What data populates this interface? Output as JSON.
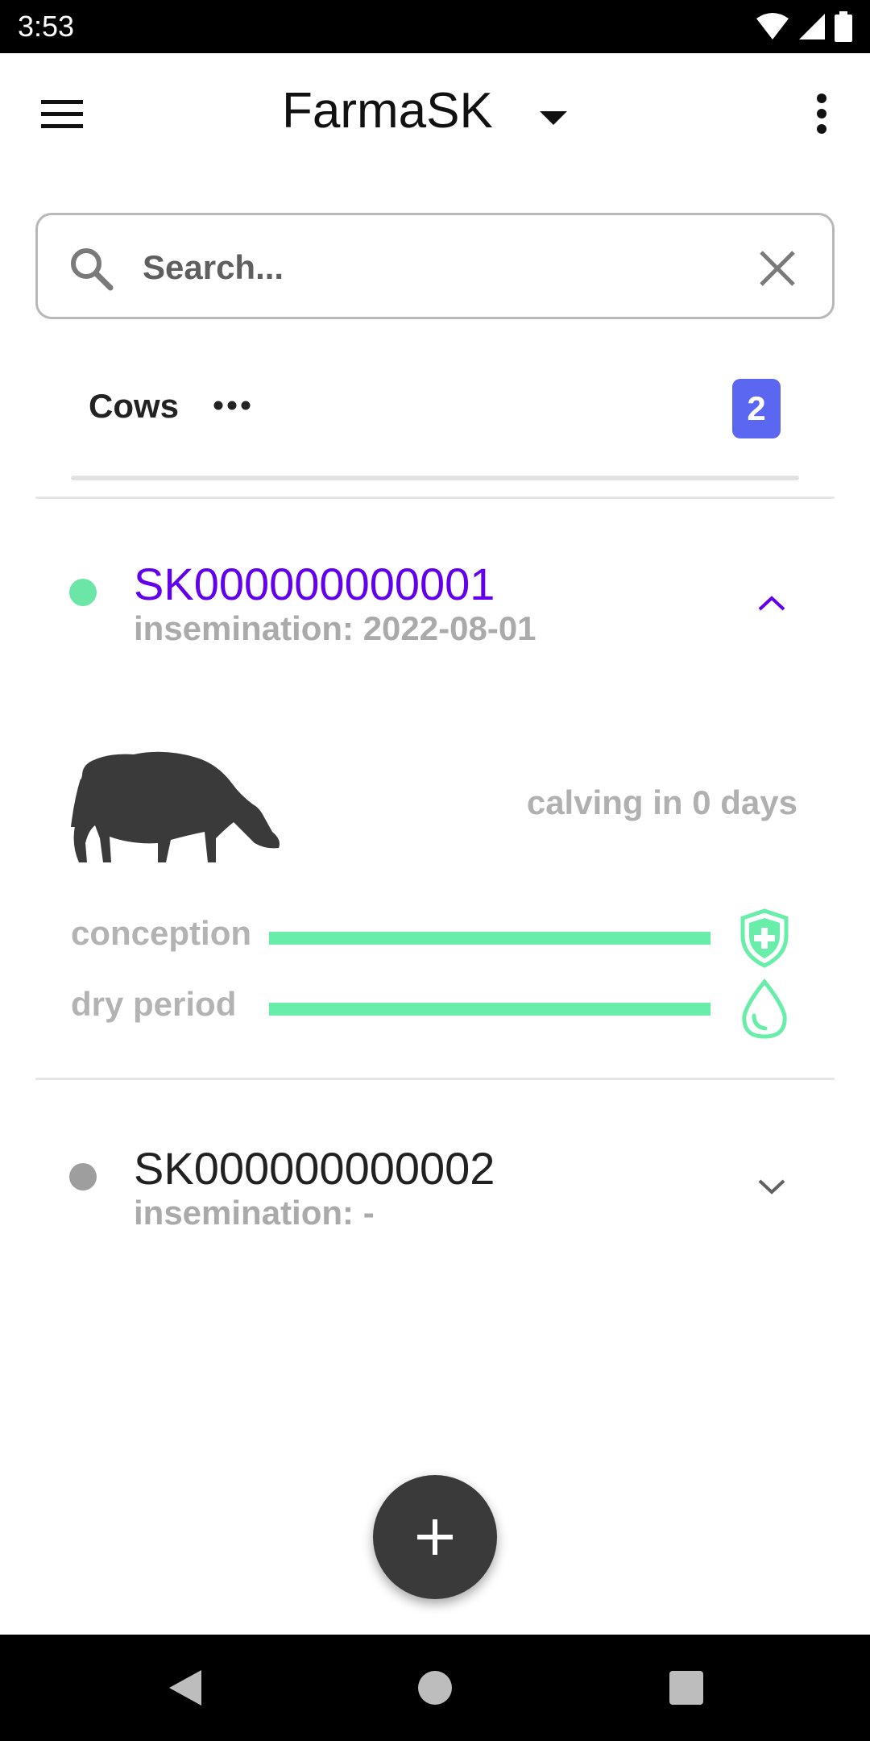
{
  "status_bar": {
    "time": "3:53"
  },
  "app_bar": {
    "title": "FarmaSK"
  },
  "search": {
    "placeholder": "Search..."
  },
  "section": {
    "label": "Cows",
    "count": "2"
  },
  "cows": [
    {
      "id": "SK000000000001",
      "subtitle": "insemination: 2022-08-01",
      "status_color": "#6ce6a6",
      "id_color": "#6200ee",
      "expanded": true,
      "calving_text": "calving in 0 days",
      "metrics": [
        {
          "label": "conception",
          "progress": 1.0,
          "icon": "shield-plus-icon"
        },
        {
          "label": "dry period",
          "progress": 1.0,
          "icon": "water-drop-icon"
        }
      ]
    },
    {
      "id": "SK000000000002",
      "subtitle": "insemination: -",
      "status_color": "#9e9e9e",
      "id_color": "#212121",
      "expanded": false
    }
  ],
  "colors": {
    "accent": "#6200ee",
    "badge": "#5b67f1",
    "progress": "#69eeaa",
    "fab": "#3a3a3a"
  }
}
